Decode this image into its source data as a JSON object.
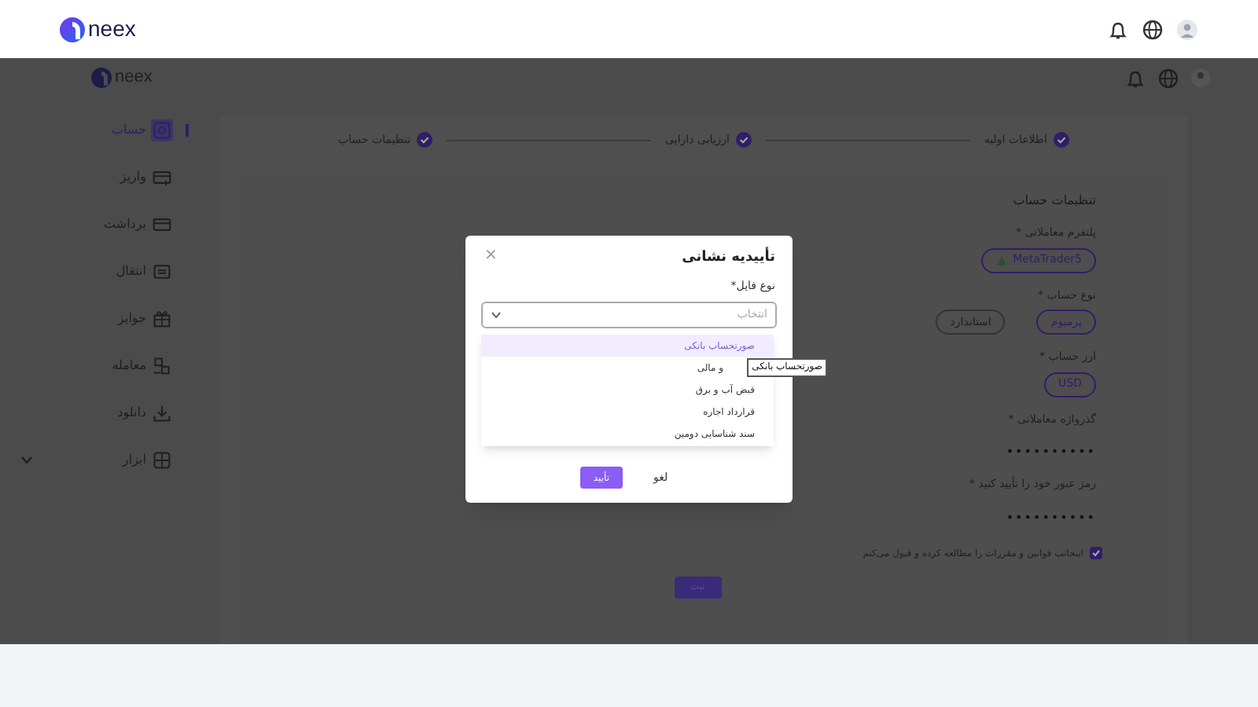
{
  "app_bar": {
    "logo": "neex"
  },
  "page": {
    "header": {
      "logo": "neex"
    },
    "sidebar": {
      "items": [
        {
          "label": "حساب",
          "selected": true,
          "kind": "link"
        },
        {
          "label": "واریز",
          "selected": false,
          "kind": "link"
        },
        {
          "label": "برداشت",
          "selected": false,
          "kind": "link"
        },
        {
          "label": "انتقال",
          "selected": false,
          "kind": "link"
        },
        {
          "label": "جوایز",
          "selected": false,
          "kind": "link"
        },
        {
          "label": "معامله",
          "selected": false,
          "kind": "link"
        },
        {
          "label": "دانلود",
          "selected": false,
          "kind": "link"
        },
        {
          "label": "ابزار",
          "selected": false,
          "kind": "group"
        }
      ]
    },
    "steps": [
      {
        "label": "اطلاعات اولیه",
        "done": true
      },
      {
        "label": "ارزیابی دارایی",
        "done": true
      },
      {
        "label": "تنظیمات حساب",
        "done": true
      }
    ],
    "form": {
      "title": "تنظیمات حساب",
      "platform": {
        "label": "* پلتفرم معاملاتی",
        "options": [
          {
            "label": "MetaTrader5",
            "selected": true
          }
        ]
      },
      "account_type": {
        "label": "* نوع حساب",
        "options": [
          {
            "label": "پرمیوم",
            "selected": true
          },
          {
            "label": "استاندارد",
            "selected": false
          }
        ]
      },
      "currency": {
        "label": "* ارز حساب",
        "options": [
          {
            "label": "USD",
            "selected": true
          }
        ]
      },
      "password": {
        "label": "* گذرواژه معاملاتی",
        "value": "••••••••••"
      },
      "confirm_password": {
        "label": "* رمز عبور خود را تأیید کنید",
        "value": "••••••••••"
      },
      "terms": {
        "text": "اینجانب قوانین و مقررات را مطالعه کرده و قبول می‌کنم",
        "checked": true
      },
      "submit": "ثبت"
    }
  },
  "dialog": {
    "title": "تأییدیه نشانی",
    "close": "×",
    "field_label": "*نوع فایل",
    "select": {
      "placeholder": "انتخاب"
    },
    "options": [
      {
        "label": "صورتحساب بانکی",
        "highlighted": true
      },
      {
        "label": "و مالی",
        "highlighted": false,
        "tooltip": "صورتحساب بانکی"
      },
      {
        "label": "قبض آب و برق",
        "highlighted": false
      },
      {
        "label": "قرارداد اجاره",
        "highlighted": false
      },
      {
        "label": "سند شناسایی دومین",
        "highlighted": false
      }
    ],
    "buttons": {
      "confirm": "تأیید",
      "cancel": "لغو"
    }
  }
}
